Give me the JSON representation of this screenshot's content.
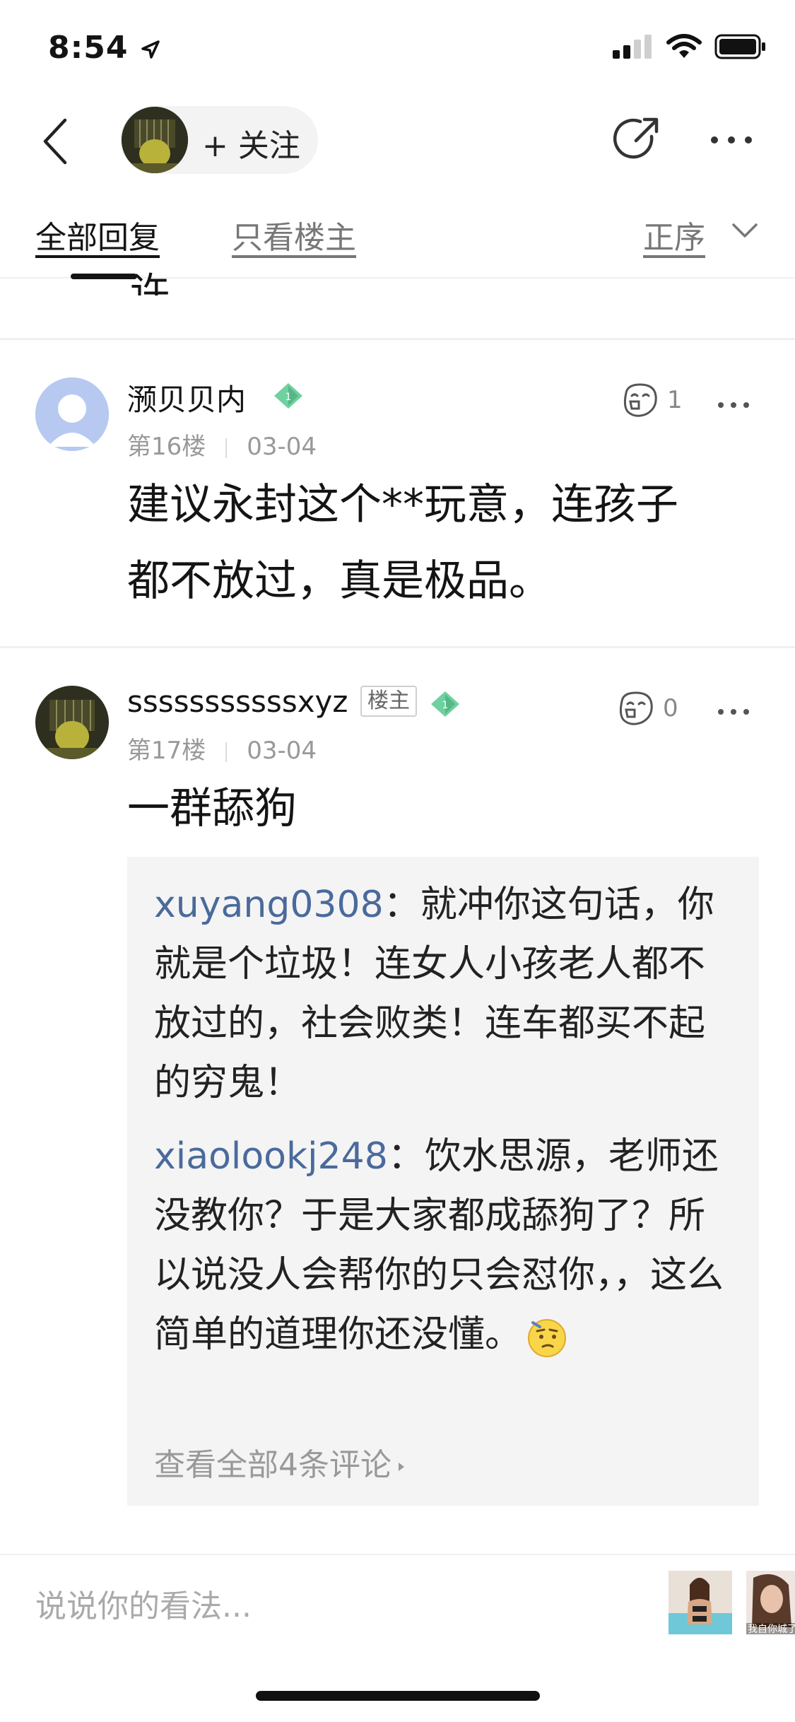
{
  "status_bar": {
    "time": "8:54"
  },
  "nav": {
    "follow_label": "+ 关注"
  },
  "tabs": {
    "all": "全部回复",
    "owner_only": "只看楼主",
    "sort": "正序"
  },
  "partial_prev_text": "许。",
  "posts": [
    {
      "username": "滪贝贝内",
      "floor": "第16楼",
      "date": "03-04",
      "likes": "1",
      "content_line1": "建议永封这个**玩意，连孩子",
      "content_line2": "都不放过，真是极品。"
    },
    {
      "username": "sssssssssssxyz",
      "owner_tag": "楼主",
      "floor": "第17楼",
      "date": "03-04",
      "likes": "0",
      "content": "一群舔狗",
      "replies": [
        {
          "user": "xuyang0308",
          "sep": "：",
          "text": "就冲你这句话，你就是个垃圾！连女人小孩老人都不放过的，社会败类！连车都买不起的穷鬼！"
        },
        {
          "user": "xiaolookj248",
          "sep": "：",
          "text": "饮水思源，老师还没教你？于是大家都成舔狗了？所以说没人会帮你的只会怼你，，这么简单的道理你还没懂。"
        }
      ],
      "view_all": "查看全部4条评论"
    }
  ],
  "bottom_bar": {
    "comment_placeholder": "说说你的看法...",
    "thumb_caption": "我自你城了"
  },
  "colors": {
    "link_blue": "#4a6a9c",
    "gem_green": "#6fd0a0",
    "reply_bg": "#f4f4f4"
  }
}
